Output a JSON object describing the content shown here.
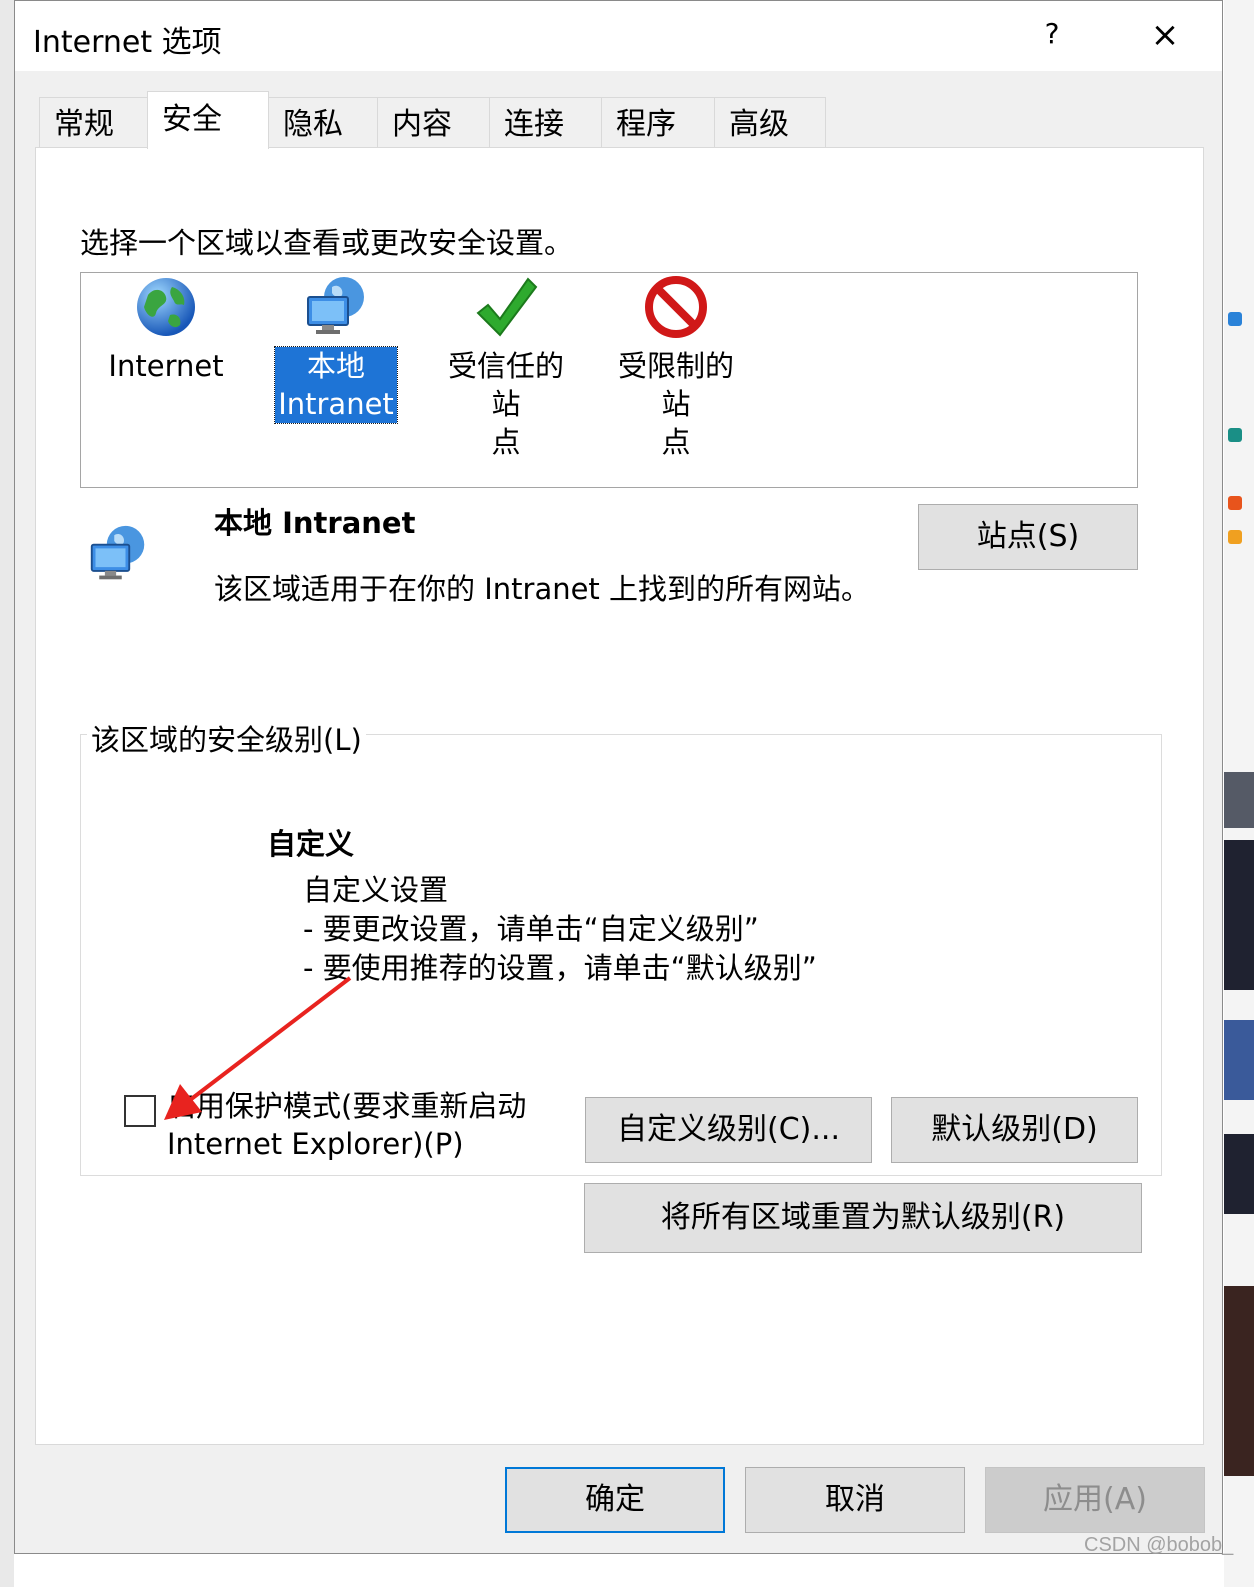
{
  "window": {
    "title": "Internet 选项",
    "help_label": "?",
    "close_label": "×"
  },
  "tabs": [
    {
      "label": "常规"
    },
    {
      "label": "安全"
    },
    {
      "label": "隐私"
    },
    {
      "label": "内容"
    },
    {
      "label": "连接"
    },
    {
      "label": "程序"
    },
    {
      "label": "高级"
    }
  ],
  "selected_tab": "安全",
  "security": {
    "intro": "选择一个区域以查看或更改安全设置。",
    "zones": [
      {
        "label_line1": "Internet",
        "label_line2": "",
        "icon": "globe-icon"
      },
      {
        "label_line1": "本地",
        "label_line2": "Intranet",
        "icon": "network-computer-icon"
      },
      {
        "label_line1": "受信任的站",
        "label_line2": "点",
        "icon": "checkmark-icon"
      },
      {
        "label_line1": "受限制的站",
        "label_line2": "点",
        "icon": "forbidden-icon"
      }
    ],
    "selected_zone": "本地 Intranet",
    "zone_info": {
      "name": "本地 Intranet",
      "description": "该区域适用于在你的 Intranet 上找到的所有网站。",
      "icon": "network-computer-icon"
    },
    "sites_button": "站点(S)",
    "level_group": {
      "legend": "该区域的安全级别(L)",
      "level_title": "自定义",
      "level_desc_line1": "自定义设置",
      "level_desc_line2": "- 要更改设置，请单击“自定义级别”",
      "level_desc_line3": "- 要使用推荐的设置，请单击“默认级别”",
      "protected_mode_line1": "启用保护模式(要求重新启动",
      "protected_mode_line2": "Internet Explorer)(P)",
      "protected_mode_checked": false,
      "custom_level_button": "自定义级别(C)...",
      "default_level_button": "默认级别(D)"
    },
    "reset_all_button": "将所有区域重置为默认级别(R)"
  },
  "footer": {
    "ok": "确定",
    "cancel": "取消",
    "apply": "应用(A)",
    "apply_enabled": false
  },
  "annotation": {
    "arrow_color": "#e8231f"
  },
  "watermark": "CSDN @bobob_",
  "colors": {
    "selection": "#1e74d6",
    "focus_border": "#0078d7",
    "button_face": "#e1e1e1"
  }
}
